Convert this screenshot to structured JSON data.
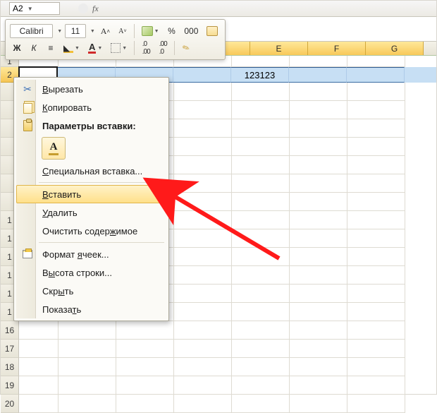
{
  "namebox": {
    "value": "A2"
  },
  "mini_toolbar": {
    "font_name": "Calibri",
    "font_size": "11",
    "percent": "%",
    "thousands": "000"
  },
  "columns": [
    "E",
    "F",
    "G"
  ],
  "row_numbers": [
    "1",
    "2",
    "",
    "",
    "",
    "",
    "",
    "",
    "",
    "1",
    "1",
    "1",
    "1",
    "1",
    "1",
    "16",
    "17",
    "18",
    "19",
    "20"
  ],
  "selected_row": {
    "value": "123123"
  },
  "context_menu": {
    "cut": "Вырезать",
    "copy": "Копировать",
    "paste_header": "Параметры вставки:",
    "paste_special": "Специальная вставка...",
    "insert": "Вставить",
    "delete": "Удалить",
    "clear": "Очистить содержимое",
    "format_cells": "Формат ячеек...",
    "row_height": "Высота строки...",
    "hide": "Скрыть",
    "show": "Показать"
  }
}
